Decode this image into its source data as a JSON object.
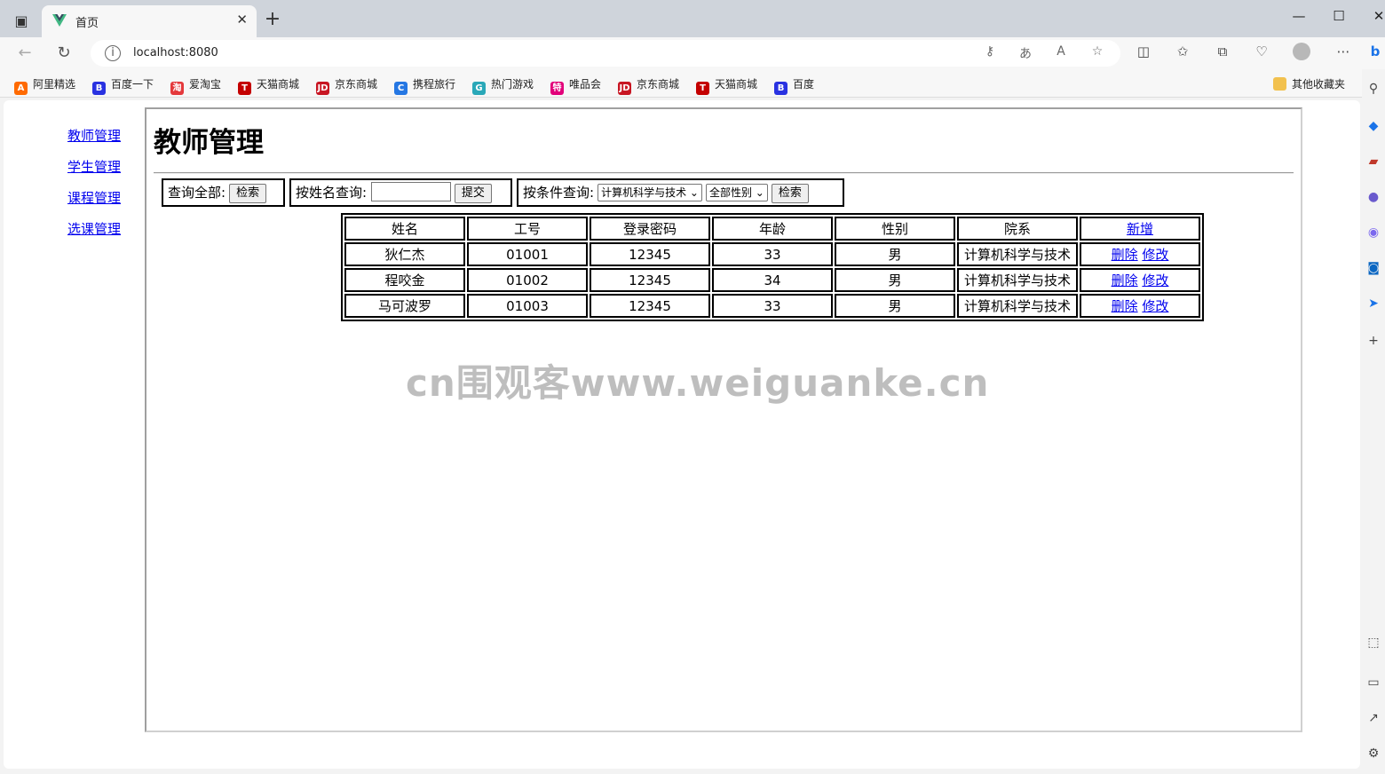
{
  "browser": {
    "tab_title": "首页",
    "url": "localhost:8080"
  },
  "bookmarks": [
    {
      "label": "阿里精选",
      "color": "#ff6a00",
      "glyph": "A"
    },
    {
      "label": "百度一下",
      "color": "#2932e1",
      "glyph": "B"
    },
    {
      "label": "爱淘宝",
      "color": "#e4393c",
      "glyph": "淘"
    },
    {
      "label": "天猫商城",
      "color": "#c40000",
      "glyph": "T"
    },
    {
      "label": "京东商城",
      "color": "#c81623",
      "glyph": "JD"
    },
    {
      "label": "携程旅行",
      "color": "#2577e3",
      "glyph": "C"
    },
    {
      "label": "热门游戏",
      "color": "#2aa8b8",
      "glyph": "G"
    },
    {
      "label": "唯品会",
      "color": "#e2007a",
      "glyph": "特"
    },
    {
      "label": "京东商城",
      "color": "#c81623",
      "glyph": "JD"
    },
    {
      "label": "天猫商城",
      "color": "#c40000",
      "glyph": "T"
    },
    {
      "label": "百度",
      "color": "#2932e1",
      "glyph": "B"
    }
  ],
  "other_bookmarks": "其他收藏夹",
  "nav": {
    "teacher": "教师管理",
    "student": "学生管理",
    "course": "课程管理",
    "selection": "选课管理"
  },
  "page": {
    "title": "教师管理",
    "query_all_label": "查询全部:",
    "query_all_button": "检索",
    "query_name_label": "按姓名查询:",
    "query_name_value": "",
    "query_name_button": "提交",
    "query_cond_label": "按条件查询:",
    "dept_selected": "计算机科学与技术",
    "gender_selected": "全部性别",
    "query_cond_button": "检索"
  },
  "table": {
    "headers": [
      "姓名",
      "工号",
      "登录密码",
      "年龄",
      "性别",
      "院系"
    ],
    "add_label": "新增",
    "delete_label": "删除",
    "edit_label": "修改",
    "rows": [
      [
        "狄仁杰",
        "01001",
        "12345",
        "33",
        "男",
        "计算机科学与技术"
      ],
      [
        "程咬金",
        "01002",
        "12345",
        "34",
        "男",
        "计算机科学与技术"
      ],
      [
        "马可波罗",
        "01003",
        "12345",
        "33",
        "男",
        "计算机科学与技术"
      ]
    ]
  },
  "watermark": "cn围观客www.weiguanke.cn"
}
